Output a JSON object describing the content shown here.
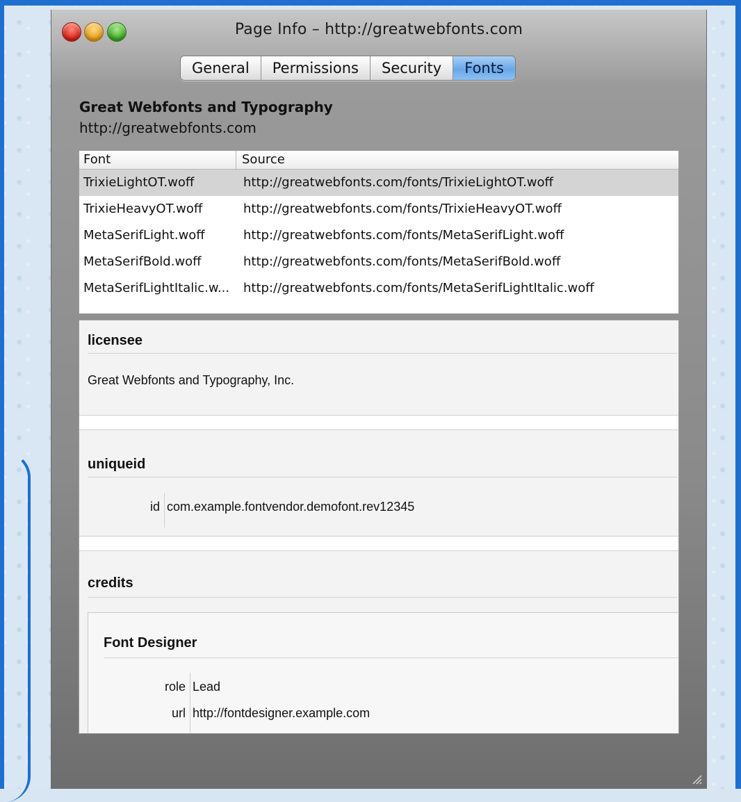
{
  "window": {
    "title": "Page Info – http://greatwebfonts.com"
  },
  "tabs": [
    {
      "label": "General",
      "active": false
    },
    {
      "label": "Permissions",
      "active": false
    },
    {
      "label": "Security",
      "active": false
    },
    {
      "label": "Fonts",
      "active": true
    }
  ],
  "site": {
    "name": "Great Webfonts and Typography",
    "url": "http://greatwebfonts.com"
  },
  "font_table": {
    "headers": {
      "font": "Font",
      "source": "Source"
    },
    "rows": [
      {
        "font": "TrixieLightOT.woff",
        "source": "http://greatwebfonts.com/fonts/TrixieLightOT.woff",
        "selected": true
      },
      {
        "font": "TrixieHeavyOT.woff",
        "source": "http://greatwebfonts.com/fonts/TrixieHeavyOT.woff",
        "selected": false
      },
      {
        "font": "MetaSerifLight.woff",
        "source": "http://greatwebfonts.com/fonts/MetaSerifLight.woff",
        "selected": false
      },
      {
        "font": "MetaSerifBold.woff",
        "source": "http://greatwebfonts.com/fonts/MetaSerifBold.woff",
        "selected": false
      },
      {
        "font": "MetaSerifLightItalic.w...",
        "source": "http://greatwebfonts.com/fonts/MetaSerifLightItalic.woff",
        "selected": false
      }
    ]
  },
  "metadata": {
    "licensee": {
      "title": "licensee",
      "value": "Great Webfonts and Typography, Inc."
    },
    "uniqueid": {
      "title": "uniqueid",
      "key": "id",
      "value": "com.example.fontvendor.demofont.rev12345"
    },
    "credits": {
      "title": "credits",
      "designer": {
        "title": "Font Designer",
        "role_key": "role",
        "role_value": "Lead",
        "url_key": "url",
        "url_value": "http://fontdesigner.example.com"
      }
    }
  },
  "colors": {
    "desktop_frame": "#1f6fd0",
    "active_tab": "#6aa7e8",
    "selected_row": "#d4d4d4"
  }
}
